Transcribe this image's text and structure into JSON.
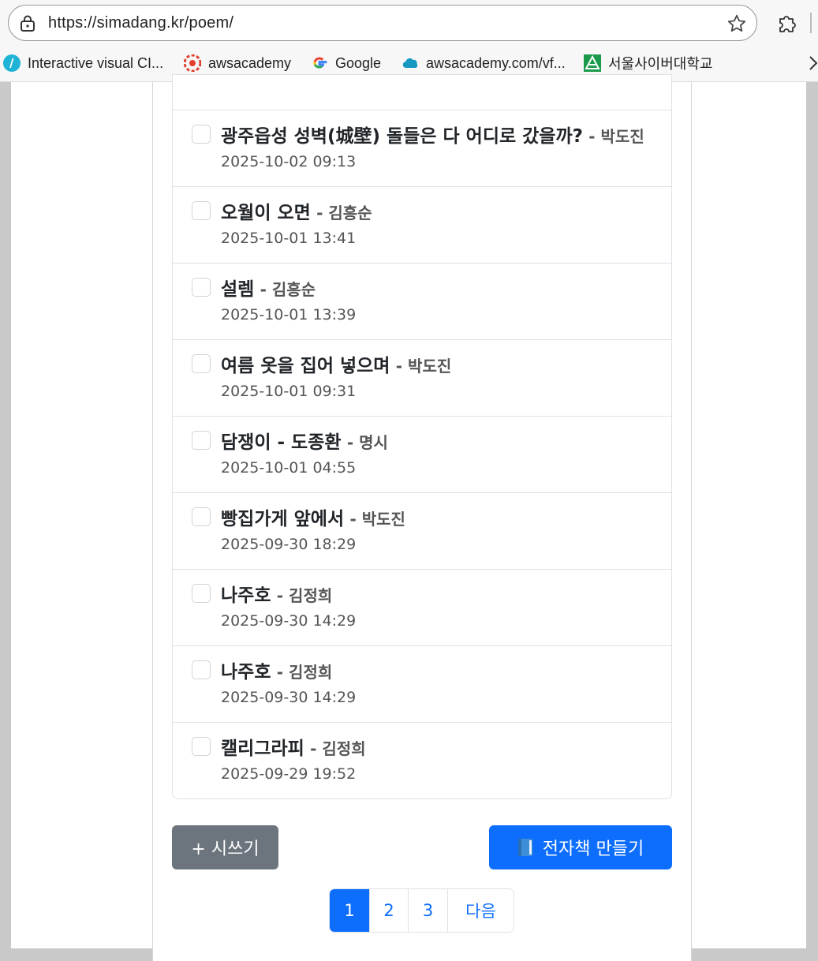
{
  "browser": {
    "url": "https://simadang.kr/poem/",
    "bookmarks": [
      {
        "label": "Interactive visual CI...",
        "icon": "slash-circle-icon"
      },
      {
        "label": "awsacademy",
        "icon": "canvas-icon"
      },
      {
        "label": "Google",
        "icon": "google-icon"
      },
      {
        "label": "awsacademy.com/vf...",
        "icon": "salesforce-cloud-icon"
      },
      {
        "label": "서울사이버대학교",
        "icon": "university-logo-icon"
      }
    ]
  },
  "poems": [
    {
      "title": "광주읍성 성벽(城壁) 돌들은 다 어디로 갔을까?",
      "author": "- 박도진",
      "date": "2025-10-02 09:13"
    },
    {
      "title": "오월이 오면",
      "author": "- 김흥순",
      "date": "2025-10-01 13:41"
    },
    {
      "title": "설렘",
      "author": "- 김흥순",
      "date": "2025-10-01 13:39"
    },
    {
      "title": "여름 옷을 집어 넣으며",
      "author": "- 박도진",
      "date": "2025-10-01 09:31"
    },
    {
      "title": "담쟁이 - 도종환",
      "author": "- 명시",
      "date": "2025-10-01 04:55"
    },
    {
      "title": "빵집가게 앞에서",
      "author": "- 박도진",
      "date": "2025-09-30 18:29"
    },
    {
      "title": "나주호",
      "author": "- 김정희",
      "date": "2025-09-30 14:29"
    },
    {
      "title": "나주호",
      "author": "- 김정희",
      "date": "2025-09-30 14:29"
    },
    {
      "title": "캘리그라피",
      "author": "- 김정희",
      "date": "2025-09-29 19:52"
    }
  ],
  "actions": {
    "write_label": "+ 시쓰기",
    "ebook_label": "전자책 만들기",
    "ebook_icon": "book-icon"
  },
  "pagination": {
    "pages": [
      "1",
      "2",
      "3"
    ],
    "active": "1",
    "next_label": "다음"
  },
  "colors": {
    "primary": "#0d6efd",
    "secondary": "#6c757d",
    "text": "#212529",
    "muted": "#555555"
  }
}
